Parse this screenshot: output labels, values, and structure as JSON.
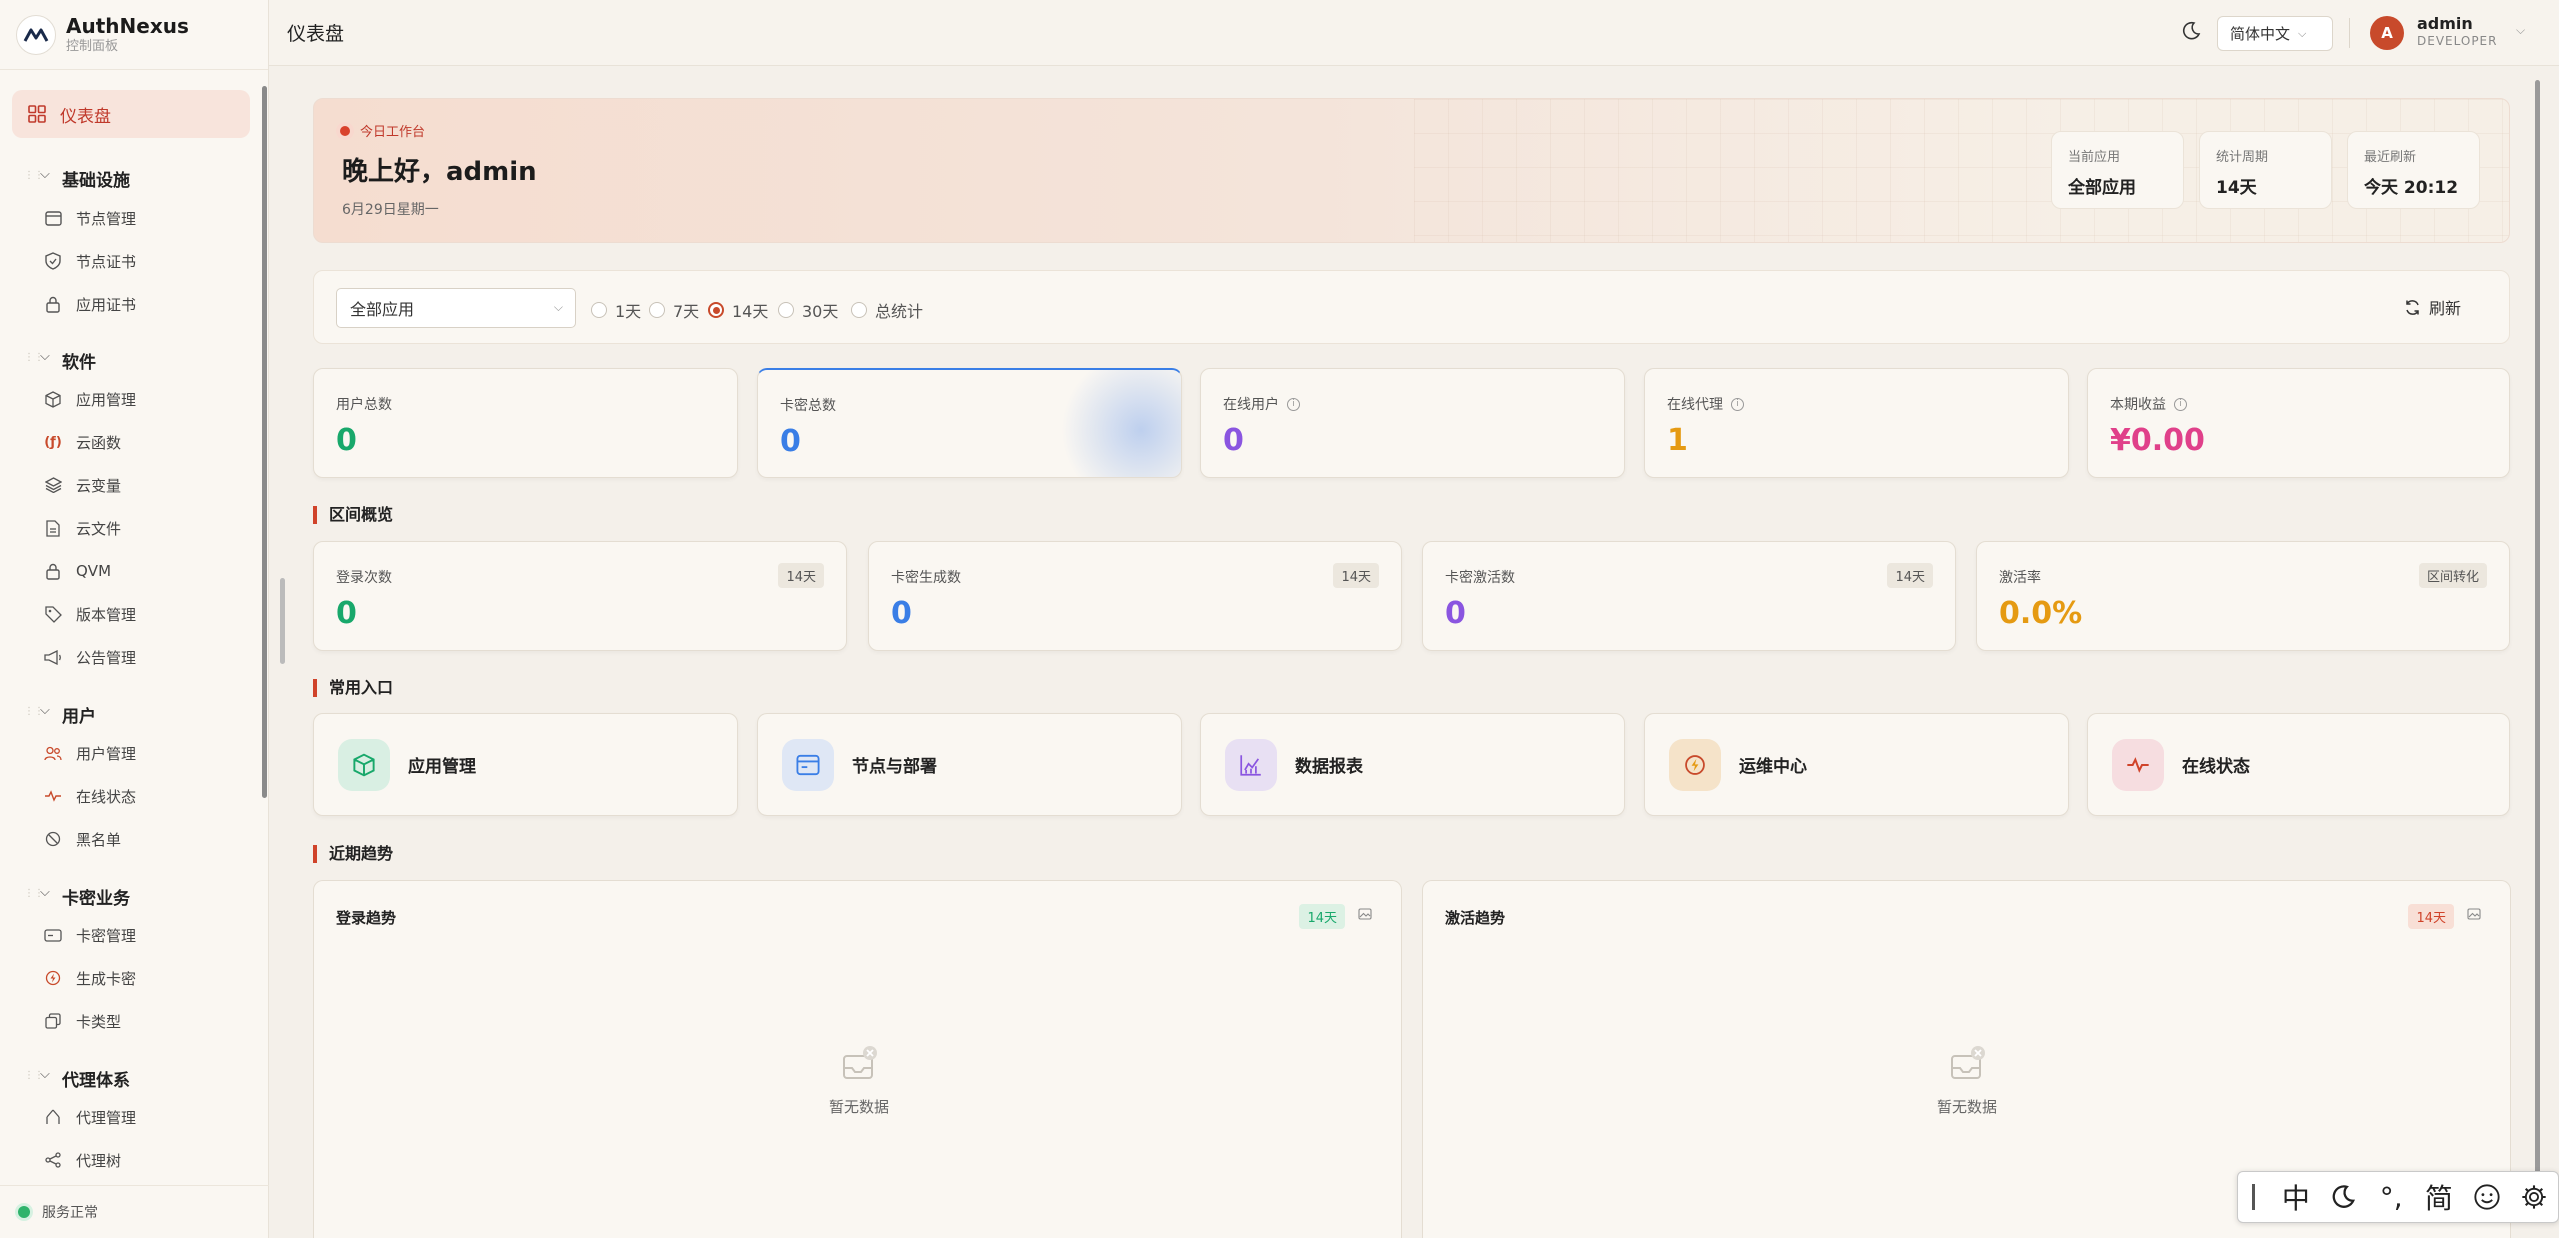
{
  "brand": {
    "title": "AuthNexus",
    "subtitle": "控制面板"
  },
  "sidebar": {
    "home": "仪表盘",
    "groups": [
      {
        "label": "基础设施",
        "items": [
          "节点管理",
          "节点证书",
          "应用证书"
        ]
      },
      {
        "label": "软件",
        "items": [
          "应用管理",
          "云函数",
          "云变量",
          "云文件",
          "QVM",
          "版本管理",
          "公告管理"
        ]
      },
      {
        "label": "用户",
        "items": [
          "用户管理",
          "在线状态",
          "黑名单"
        ]
      },
      {
        "label": "卡密业务",
        "items": [
          "卡密管理",
          "生成卡密",
          "卡类型"
        ]
      },
      {
        "label": "代理体系",
        "items": [
          "代理管理",
          "代理树"
        ]
      }
    ],
    "footer_status": "服务正常"
  },
  "header": {
    "title": "仪表盘",
    "language": "简体中文",
    "user": {
      "initial": "A",
      "name": "admin",
      "role": "DEVELOPER"
    }
  },
  "hero": {
    "tag": "今日工作台",
    "greeting": "晚上好，admin",
    "date": "6月29日星期一",
    "cards": [
      {
        "label": "当前应用",
        "value": "全部应用"
      },
      {
        "label": "统计周期",
        "value": "14天"
      },
      {
        "label": "最近刷新",
        "value": "今天 20:12"
      }
    ]
  },
  "filters": {
    "app": "全部应用",
    "periods": [
      "1天",
      "7天",
      "14天",
      "30天",
      "总统计"
    ],
    "selected_period": "14天",
    "refresh": "刷新"
  },
  "stats": [
    {
      "label": "用户总数",
      "value": "0",
      "color": "#18a86b"
    },
    {
      "label": "卡密总数",
      "value": "0",
      "color": "#3a7ee6"
    },
    {
      "label": "在线用户",
      "value": "0",
      "color": "#8a55e0"
    },
    {
      "label": "在线代理",
      "value": "1",
      "color": "#e59a12"
    },
    {
      "label": "本期收益",
      "value": "¥0.00",
      "color": "#e0408a"
    }
  ],
  "sections": {
    "range": "区间概览",
    "entries": "常用入口",
    "trends": "近期趋势"
  },
  "range_cards": [
    {
      "label": "登录次数",
      "value": "0",
      "badge": "14天",
      "color": "#18a86b"
    },
    {
      "label": "卡密生成数",
      "value": "0",
      "badge": "14天",
      "color": "#3a7ee6"
    },
    {
      "label": "卡密激活数",
      "value": "0",
      "badge": "14天",
      "color": "#8a55e0"
    },
    {
      "label": "激活率",
      "value": "0.0%",
      "badge": "区间转化",
      "color": "#e59a12"
    }
  ],
  "entries": [
    {
      "label": "应用管理",
      "icon": "cube-icon"
    },
    {
      "label": "节点与部署",
      "icon": "server-icon"
    },
    {
      "label": "数据报表",
      "icon": "chart-icon"
    },
    {
      "label": "运维中心",
      "icon": "bolt-icon"
    },
    {
      "label": "在线状态",
      "icon": "pulse-icon"
    }
  ],
  "trends": [
    {
      "title": "登录趋势",
      "badge": "14天",
      "empty": "暂无数据"
    },
    {
      "title": "激活趋势",
      "badge": "14天",
      "empty": "暂无数据"
    }
  ],
  "ime": {
    "mode": "中",
    "width": "°,",
    "script": "简"
  }
}
